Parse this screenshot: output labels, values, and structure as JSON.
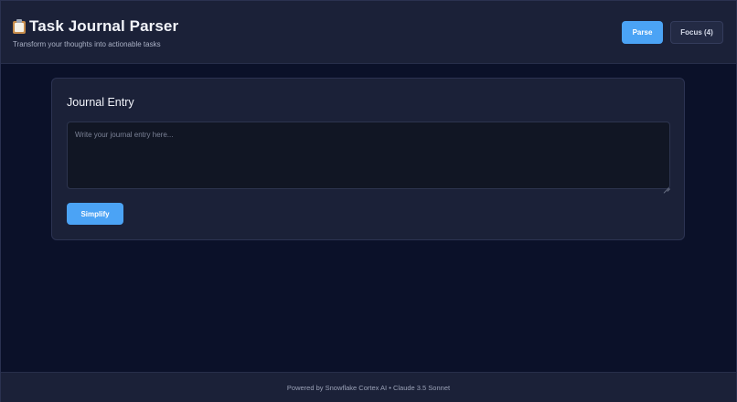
{
  "header": {
    "title": "Task Journal Parser",
    "title_icon": "clipboard-icon",
    "subtitle": "Transform your thoughts into actionable tasks",
    "parse_label": "Parse",
    "focus_label": "Focus (4)"
  },
  "journal": {
    "heading": "Journal Entry",
    "value": "",
    "placeholder": "Write your journal entry here...",
    "simplify_label": "Simplify"
  },
  "footer": {
    "text": "Powered by Snowflake Cortex AI • Claude 3.5 Sonnet"
  },
  "colors": {
    "background": "#0b1129",
    "panel": "#1b2138",
    "accent": "#4ba3f5"
  }
}
